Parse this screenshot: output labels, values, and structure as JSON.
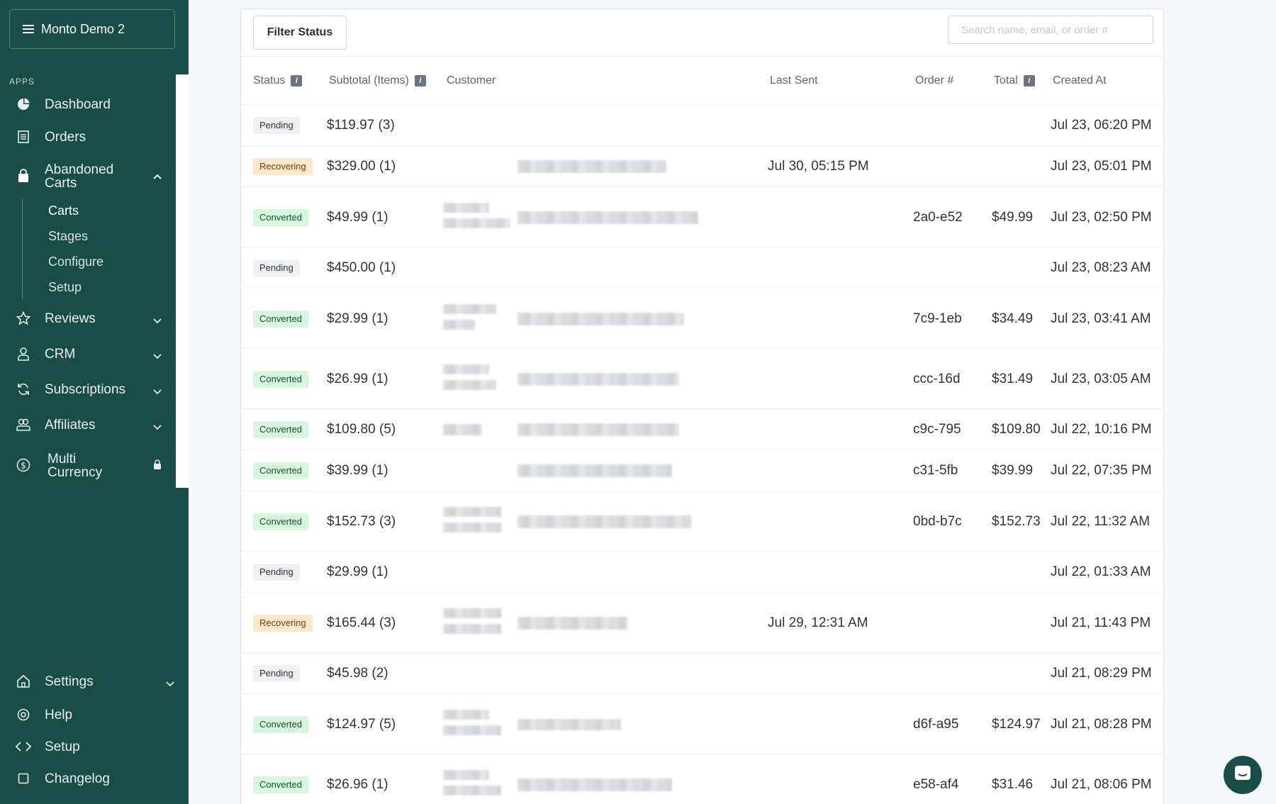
{
  "sidebar": {
    "workspace": "Monto Demo 2",
    "apps_label": "APPS",
    "nav": {
      "dashboard": "Dashboard",
      "orders": "Orders",
      "abandoned": "Abandoned Carts",
      "reviews": "Reviews",
      "crm": "CRM",
      "subscriptions": "Subscriptions",
      "affiliates": "Affiliates",
      "multicurrency": "Multi Currency",
      "settings": "Settings",
      "help": "Help",
      "setup": "Setup",
      "changelog": "Changelog"
    },
    "sub": {
      "carts": "Carts",
      "stages": "Stages",
      "configure": "Configure",
      "setup": "Setup"
    }
  },
  "toolbar": {
    "filter_label": "Filter Status",
    "search_placeholder": "Search name, email, or order #"
  },
  "table": {
    "headers": {
      "status": "Status",
      "subtotal": "Subtotal (Items)",
      "customer": "Customer",
      "last_sent": "Last Sent",
      "order": "Order #",
      "total": "Total",
      "created": "Created At"
    },
    "rows": [
      {
        "status": "Pending",
        "subtotal": "$119.97 (3)",
        "last_sent": "",
        "order": "",
        "total": "",
        "created": "Jul 23, 06:20 PM"
      },
      {
        "status": "Recovering",
        "subtotal": "$329.00 (1)",
        "last_sent": "Jul 30, 05:15 PM",
        "order": "",
        "total": "",
        "created": "Jul 23, 05:01 PM"
      },
      {
        "status": "Converted",
        "subtotal": "$49.99 (1)",
        "last_sent": "",
        "order": "2a0-e52",
        "total": "$49.99",
        "created": "Jul 23, 02:50 PM"
      },
      {
        "status": "Pending",
        "subtotal": "$450.00 (1)",
        "last_sent": "",
        "order": "",
        "total": "",
        "created": "Jul 23, 08:23 AM"
      },
      {
        "status": "Converted",
        "subtotal": "$29.99 (1)",
        "last_sent": "",
        "order": "7c9-1eb",
        "total": "$34.49",
        "created": "Jul 23, 03:41 AM"
      },
      {
        "status": "Converted",
        "subtotal": "$26.99 (1)",
        "last_sent": "",
        "order": "ccc-16d",
        "total": "$31.49",
        "created": "Jul 23, 03:05 AM"
      },
      {
        "status": "Converted",
        "subtotal": "$109.80 (5)",
        "last_sent": "",
        "order": "c9c-795",
        "total": "$109.80",
        "created": "Jul 22, 10:16 PM"
      },
      {
        "status": "Converted",
        "subtotal": "$39.99 (1)",
        "last_sent": "",
        "order": "c31-5fb",
        "total": "$39.99",
        "created": "Jul 22, 07:35 PM"
      },
      {
        "status": "Converted",
        "subtotal": "$152.73 (3)",
        "last_sent": "",
        "order": "0bd-b7c",
        "total": "$152.73",
        "created": "Jul 22, 11:32 AM"
      },
      {
        "status": "Pending",
        "subtotal": "$29.99 (1)",
        "last_sent": "",
        "order": "",
        "total": "",
        "created": "Jul 22, 01:33 AM"
      },
      {
        "status": "Recovering",
        "subtotal": "$165.44 (3)",
        "last_sent": "Jul 29, 12:31 AM",
        "order": "",
        "total": "",
        "created": "Jul 21, 11:43 PM"
      },
      {
        "status": "Pending",
        "subtotal": "$45.98 (2)",
        "last_sent": "",
        "order": "",
        "total": "",
        "created": "Jul 21, 08:29 PM"
      },
      {
        "status": "Converted",
        "subtotal": "$124.97 (5)",
        "last_sent": "",
        "order": "d6f-a95",
        "total": "$124.97",
        "created": "Jul 21, 08:28 PM"
      },
      {
        "status": "Converted",
        "subtotal": "$26.96 (1)",
        "last_sent": "",
        "order": "e58-af4",
        "total": "$31.46",
        "created": "Jul 21, 08:06 PM"
      }
    ]
  },
  "colors": {
    "sidebar_bg": "#194d4a",
    "pending_bg": "#eff1f3",
    "recovering_bg": "#fde8cc",
    "converted_bg": "#d8f5de"
  }
}
